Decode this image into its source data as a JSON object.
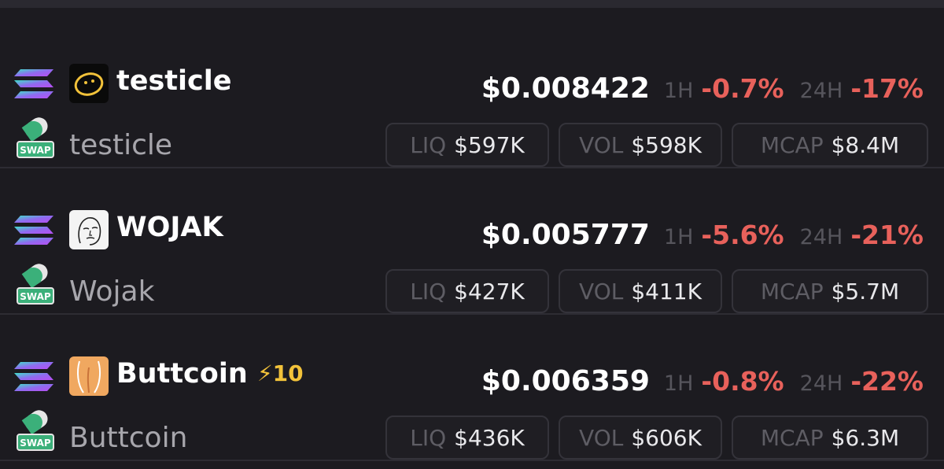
{
  "colors": {
    "background": "#1c1b20",
    "negative": "#e8615b",
    "muted_label": "#56555c",
    "boost": "#f2c23a",
    "pill_border": "#34333a"
  },
  "rows": [
    {
      "chain_icon": "solana-icon",
      "dex_icon": "raydium-swap-icon",
      "logo_icon": "testicle-logo",
      "symbol": "testicle",
      "boost": "",
      "name": "testicle",
      "price": "$0.008422",
      "h1_label": "1H",
      "h1_change": "-0.7%",
      "h24_label": "24H",
      "h24_change": "-17%",
      "liq_label": "LIQ",
      "liq_value": "$597K",
      "vol_label": "VOL",
      "vol_value": "$598K",
      "mcap_label": "MCAP",
      "mcap_value": "$8.4M"
    },
    {
      "chain_icon": "solana-icon",
      "dex_icon": "raydium-swap-icon",
      "logo_icon": "wojak-logo",
      "symbol": "WOJAK",
      "boost": "",
      "name": "Wojak",
      "price": "$0.005777",
      "h1_label": "1H",
      "h1_change": "-5.6%",
      "h24_label": "24H",
      "h24_change": "-21%",
      "liq_label": "LIQ",
      "liq_value": "$427K",
      "vol_label": "VOL",
      "vol_value": "$411K",
      "mcap_label": "MCAP",
      "mcap_value": "$5.7M"
    },
    {
      "chain_icon": "solana-icon",
      "dex_icon": "raydium-swap-icon",
      "logo_icon": "buttcoin-logo",
      "symbol": "Buttcoin",
      "boost": "⚡10",
      "name": "Buttcoin",
      "price": "$0.006359",
      "h1_label": "1H",
      "h1_change": "-0.8%",
      "h24_label": "24H",
      "h24_change": "-22%",
      "liq_label": "LIQ",
      "liq_value": "$436K",
      "vol_label": "VOL",
      "vol_value": "$606K",
      "mcap_label": "MCAP",
      "mcap_value": "$6.3M"
    }
  ]
}
